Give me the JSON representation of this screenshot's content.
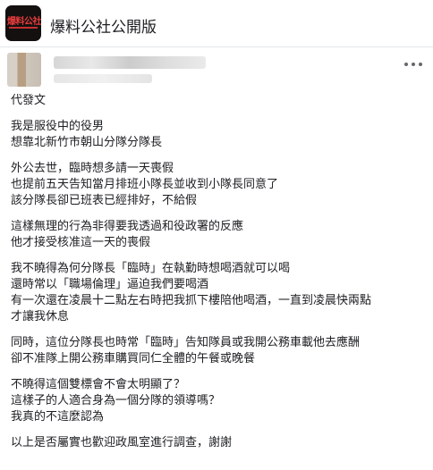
{
  "page": {
    "name": "爆料公社公開版",
    "logo_text": "爆料公社"
  },
  "post": {
    "paragraphs": [
      [
        "代發文"
      ],
      [
        "我是服役中的役男",
        "想靠北新竹市朝山分隊分隊長"
      ],
      [
        "外公去世，臨時想多請一天喪假",
        "也提前五天告知當月排班小隊長並收到小隊長同意了",
        "該分隊長卻已班表已經排好，不給假"
      ],
      [
        "這樣無理的行為非得要我透過和役政署的反應",
        "他才接受核准這一天的喪假"
      ],
      [
        "我不曉得為何分隊長「臨時」在執勤時想喝酒就可以喝",
        "還時常以「職場倫理」逼迫我們要喝酒",
        "有一次還在凌晨十二點左右時把我抓下樓陪他喝酒，一直到凌晨快兩點",
        "才讓我休息"
      ],
      [
        "同時，這位分隊長也時常「臨時」告知隊員或我開公務車載他去應酬",
        "卻不准隊上開公務車購買同仁全體的午餐或晚餐"
      ],
      [
        "不曉得這個雙標會不會太明顯了？",
        "這樣子的人適合身為一個分隊的領導嗎？",
        "我真的不這麼認為"
      ],
      [
        "以上是否屬實也歡迎政風室進行調查，謝謝"
      ]
    ]
  }
}
